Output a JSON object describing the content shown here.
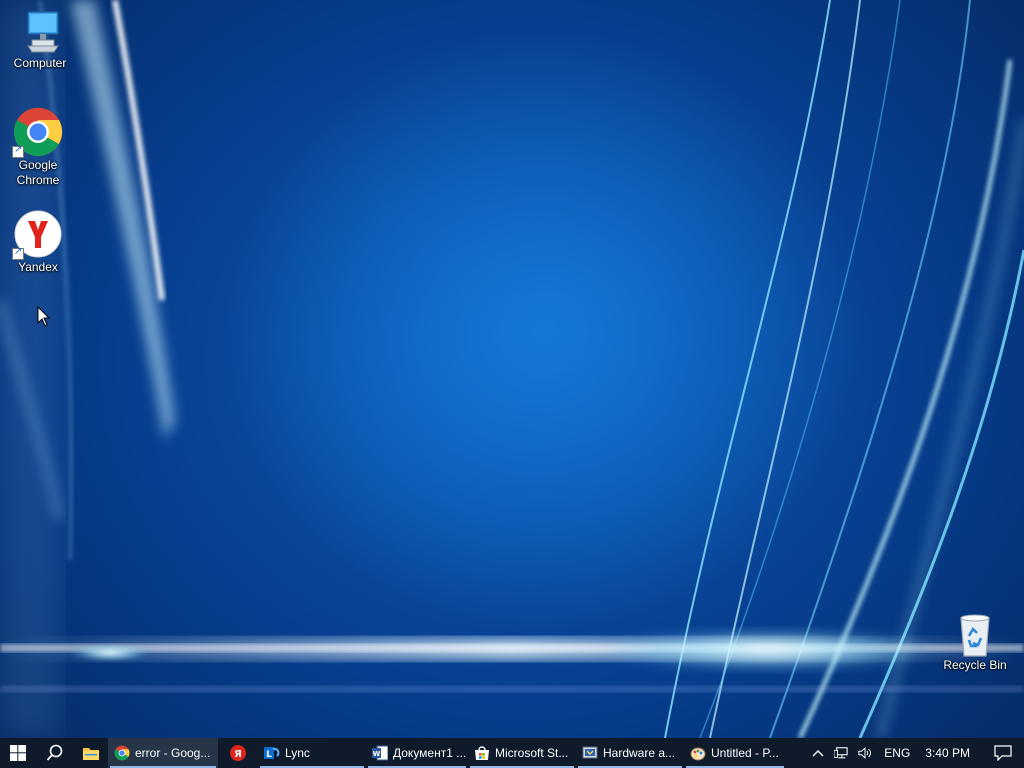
{
  "desktop": {
    "icons": [
      {
        "label": "Computer",
        "icon": "computer-icon"
      },
      {
        "label": "Google\nChrome",
        "icon": "chrome-icon"
      },
      {
        "label": "Yandex",
        "icon": "yandex-icon"
      },
      {
        "label": "Recycle Bin",
        "icon": "recycle-bin-icon"
      }
    ]
  },
  "taskbar": {
    "start_icon": "windows-logo-icon",
    "search_icon": "search-icon",
    "pinned": [
      {
        "icon": "file-explorer-icon"
      },
      {
        "icon": "yandex-browser-icon"
      }
    ],
    "apps": [
      {
        "label": "error - Goog...",
        "icon": "chrome-icon"
      },
      {
        "label": "Lync",
        "icon": "lync-icon"
      },
      {
        "label": "Документ1 ...",
        "icon": "word-icon"
      },
      {
        "label": "Microsoft St...",
        "icon": "microsoft-store-icon"
      },
      {
        "label": "Hardware a...",
        "icon": "hardware-devices-icon"
      },
      {
        "label": "Untitled - P...",
        "icon": "paint-icon"
      }
    ],
    "tray": {
      "chevron": "^",
      "language": "ENG",
      "time": "3:40 PM"
    }
  },
  "colors": {
    "taskbar_bg": "#0f1b2b",
    "desktop_center": "#1478d6",
    "desktop_edge": "#052a66"
  }
}
